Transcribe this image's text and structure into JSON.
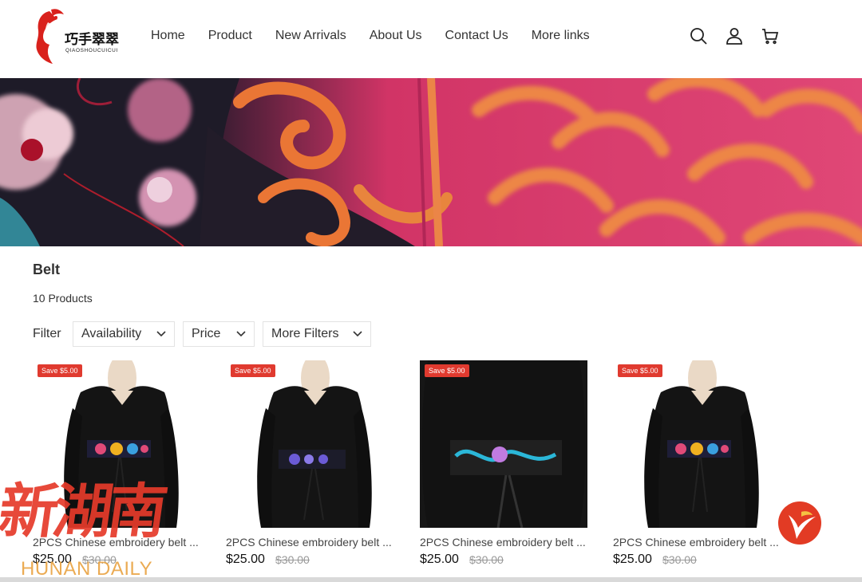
{
  "brand": {
    "name_cn": "巧手翠翠",
    "name_en": "QIAOSHOUCUICUI",
    "accent": "#d9211c"
  },
  "nav": {
    "items": [
      {
        "label": "Home"
      },
      {
        "label": "Product"
      },
      {
        "label": "New Arrivals"
      },
      {
        "label": "About Us"
      },
      {
        "label": "Contact Us"
      },
      {
        "label": "More links"
      }
    ]
  },
  "header_icons": [
    "search-icon",
    "account-icon",
    "cart-icon"
  ],
  "collection": {
    "title": "Belt",
    "count_text": "10 Products"
  },
  "filters": {
    "label": "Filter",
    "buttons": [
      {
        "label": "Availability"
      },
      {
        "label": "Price"
      },
      {
        "label": "More Filters"
      }
    ]
  },
  "products": [
    {
      "badge": "Save $5.00",
      "name": "2PCS Chinese embroidery belt ...",
      "price": "$25.00",
      "compare_price": "$30.00",
      "belt_color": "multicolor-floral"
    },
    {
      "badge": "Save $5.00",
      "name": "2PCS Chinese embroidery belt ...",
      "price": "$25.00",
      "compare_price": "$30.00",
      "belt_color": "purple-floral"
    },
    {
      "badge": "Save $5.00",
      "name": "2PCS Chinese embroidery belt ...",
      "price": "$25.00",
      "compare_price": "$30.00",
      "belt_color": "blue-bird"
    },
    {
      "badge": "Save $5.00",
      "name": "2PCS Chinese embroidery belt ...",
      "price": "$25.00",
      "compare_price": "$30.00",
      "belt_color": "multicolor-floral"
    }
  ],
  "watermark": {
    "cn": "新湖南",
    "en": "HUNAN DAILY"
  },
  "colors": {
    "sale_badge": "#e03a2f",
    "watermark_red": "#e63a2a",
    "watermark_gold": "#e9a341"
  }
}
